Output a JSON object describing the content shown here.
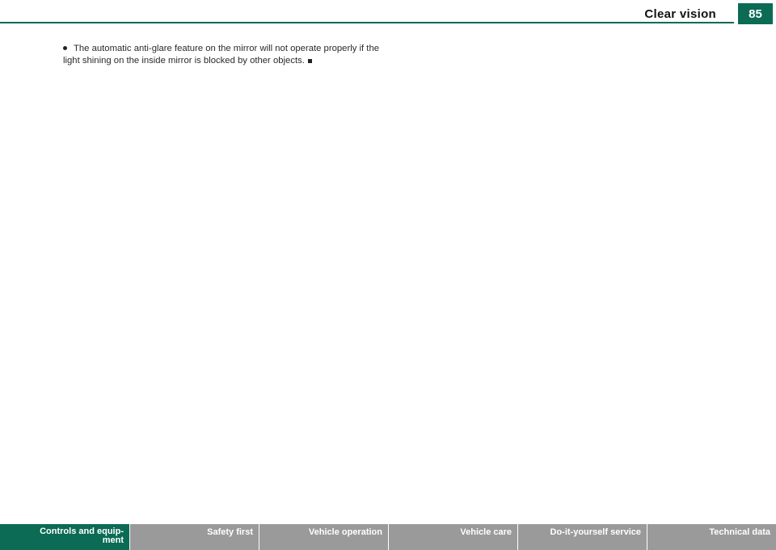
{
  "header": {
    "section_title": "Clear vision",
    "page_number": "85"
  },
  "content": {
    "paragraph": "The automatic anti-glare feature on the mirror will not operate properly if the light shining on the inside mirror is blocked by other objects."
  },
  "footer_nav": {
    "tabs": [
      {
        "label_line1": "Controls and equip-",
        "label_line2": "ment"
      },
      {
        "label": "Safety first"
      },
      {
        "label": "Vehicle operation"
      },
      {
        "label": "Vehicle care"
      },
      {
        "label": "Do-it-yourself service"
      },
      {
        "label": "Technical data"
      }
    ]
  },
  "colors": {
    "accent": "#0b6b55",
    "tab_inactive": "#9a9a9a"
  }
}
